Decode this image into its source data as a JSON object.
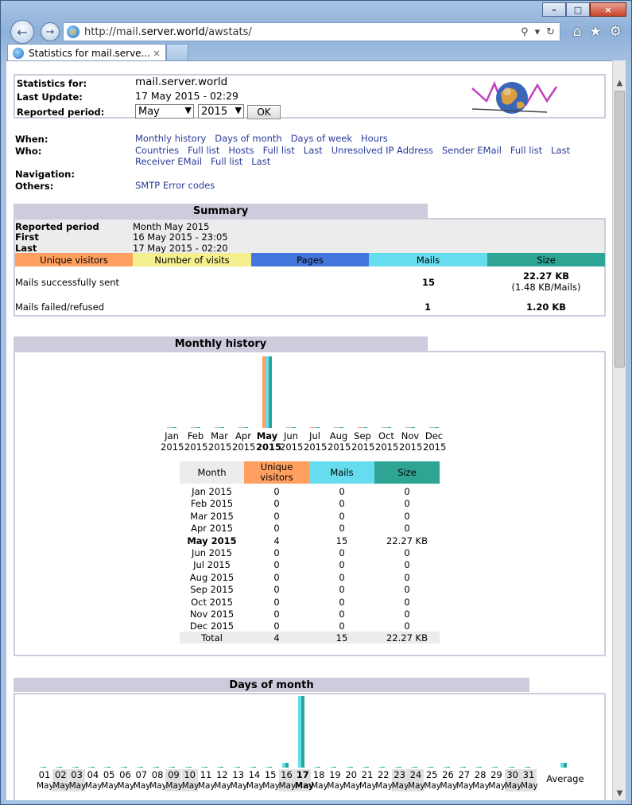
{
  "browser": {
    "url_prefix": "http://mail.",
    "url_host": "server.world",
    "url_path": "/awstats/",
    "tab_title": "Statistics for mail.serve...",
    "tab_close": "×",
    "win_min": "–",
    "win_max": "□",
    "win_close": "×"
  },
  "header": {
    "stats_for_label": "Statistics for:",
    "stats_for_value": "mail.server.world",
    "last_update_label": "Last Update:",
    "last_update_value": "17 May 2015 - 02:29",
    "reported_period_label": "Reported period:",
    "month_select": "May",
    "year_select": "2015",
    "ok_label": "OK"
  },
  "nav": {
    "when_label": "When:",
    "when_links": [
      "Monthly history",
      "Days of month",
      "Days of week",
      "Hours"
    ],
    "who_label": "Who:",
    "who_links_1": [
      "Countries",
      "Full list",
      "Hosts",
      "Full list",
      "Last",
      "Unresolved IP Address",
      "Sender EMail",
      "Full list",
      "Last"
    ],
    "who_links_2": [
      "Receiver EMail",
      "Full list",
      "Last"
    ],
    "navigation_label": "Navigation:",
    "others_label": "Others:",
    "others_links": [
      "SMTP Error codes"
    ]
  },
  "summary": {
    "title": "Summary",
    "reported_period_label": "Reported period",
    "reported_period_value": "Month May 2015",
    "first_label": "First",
    "first_value": "16 May 2015 - 23:05",
    "last_label": "Last",
    "last_value": "17 May 2015 - 02:20",
    "col_unique": "Unique visitors",
    "col_visits": "Number of visits",
    "col_pages": "Pages",
    "col_mails": "Mails",
    "col_size": "Size",
    "sent_label": "Mails successfully sent",
    "sent_mails": "15",
    "sent_size": "22.27 KB",
    "sent_size_sub": "(1.48 KB/Mails)",
    "failed_label": "Mails failed/refused",
    "failed_mails": "1",
    "failed_size": "1.20 KB"
  },
  "monthly": {
    "title": "Monthly history",
    "months": [
      {
        "m": "Jan",
        "y": "2015"
      },
      {
        "m": "Feb",
        "y": "2015"
      },
      {
        "m": "Mar",
        "y": "2015"
      },
      {
        "m": "Apr",
        "y": "2015"
      },
      {
        "m": "May",
        "y": "2015"
      },
      {
        "m": "Jun",
        "y": "2015"
      },
      {
        "m": "Jul",
        "y": "2015"
      },
      {
        "m": "Aug",
        "y": "2015"
      },
      {
        "m": "Sep",
        "y": "2015"
      },
      {
        "m": "Oct",
        "y": "2015"
      },
      {
        "m": "Nov",
        "y": "2015"
      },
      {
        "m": "Dec",
        "y": "2015"
      }
    ],
    "current_index": 4,
    "table_headers": {
      "month": "Month",
      "unique": "Unique visitors",
      "mails": "Mails",
      "size": "Size"
    },
    "rows": [
      {
        "month": "Jan 2015",
        "unique": "0",
        "mails": "0",
        "size": "0"
      },
      {
        "month": "Feb 2015",
        "unique": "0",
        "mails": "0",
        "size": "0"
      },
      {
        "month": "Mar 2015",
        "unique": "0",
        "mails": "0",
        "size": "0"
      },
      {
        "month": "Apr 2015",
        "unique": "0",
        "mails": "0",
        "size": "0"
      },
      {
        "month": "May 2015",
        "unique": "4",
        "mails": "15",
        "size": "22.27 KB"
      },
      {
        "month": "Jun 2015",
        "unique": "0",
        "mails": "0",
        "size": "0"
      },
      {
        "month": "Jul 2015",
        "unique": "0",
        "mails": "0",
        "size": "0"
      },
      {
        "month": "Aug 2015",
        "unique": "0",
        "mails": "0",
        "size": "0"
      },
      {
        "month": "Sep 2015",
        "unique": "0",
        "mails": "0",
        "size": "0"
      },
      {
        "month": "Oct 2015",
        "unique": "0",
        "mails": "0",
        "size": "0"
      },
      {
        "month": "Nov 2015",
        "unique": "0",
        "mails": "0",
        "size": "0"
      },
      {
        "month": "Dec 2015",
        "unique": "0",
        "mails": "0",
        "size": "0"
      }
    ],
    "total": {
      "label": "Total",
      "unique": "4",
      "mails": "15",
      "size": "22.27 KB"
    }
  },
  "days": {
    "title": "Days of month",
    "days": [
      "01",
      "02",
      "03",
      "04",
      "05",
      "06",
      "07",
      "08",
      "09",
      "10",
      "11",
      "12",
      "13",
      "14",
      "15",
      "16",
      "17",
      "18",
      "19",
      "20",
      "21",
      "22",
      "23",
      "24",
      "25",
      "26",
      "27",
      "28",
      "29",
      "30",
      "31"
    ],
    "month_label": "May",
    "weekend_days": [
      "02",
      "03",
      "09",
      "10",
      "16",
      "17",
      "23",
      "24",
      "30",
      "31"
    ],
    "bold_day": "17",
    "average_label": "Average",
    "mails": [
      0,
      0,
      0,
      0,
      0,
      0,
      0,
      0,
      0,
      0,
      0,
      0,
      0,
      0,
      0,
      1,
      14,
      0,
      0,
      0,
      0,
      0,
      0,
      0,
      0,
      0,
      0,
      0,
      0,
      0,
      0
    ]
  },
  "colors": {
    "unique": "#ffa060",
    "visits": "#f4f090",
    "pages": "#4477dd",
    "mails": "#66ddee",
    "size": "#2ea495",
    "section": "#ccccdd",
    "link": "#2a3a9a"
  }
}
